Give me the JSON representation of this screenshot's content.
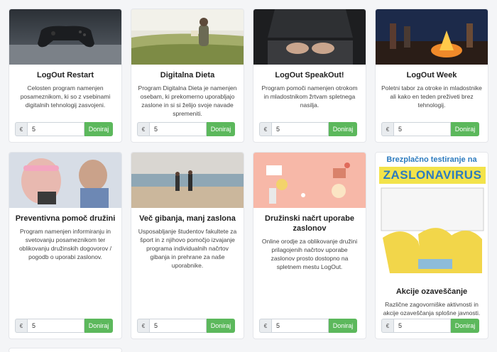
{
  "currency_symbol": "€",
  "donate_label": "Doniraj",
  "default_amount": "5",
  "programs": [
    {
      "title": "LogOut Restart",
      "desc": "Celosten program namenjen posameznikom, ki so z vsebinami digitalnih tehnologij zasvojeni."
    },
    {
      "title": "Digitalna Dieta",
      "desc": "Program Digitalna Dieta je namenjen osebam, ki prekomerno uporabljajo zaslone in si si želijo svoje navade spremeniti."
    },
    {
      "title": "LogOut SpeakOut!",
      "desc": "Program pomoči namenjen otrokom in mladostnikom žrtvam spletnega nasilja."
    },
    {
      "title": "LogOut Week",
      "desc": "Poletni tabor za otroke in mladostnike ali kako en teden preživeti brez tehnologij."
    },
    {
      "title": "Preventivna pomoč družini",
      "desc": "Program namenjen informiranju in svetovanju posameznikom ter oblikovanju družinskih dogovorov / pogodb o uporabi zaslonov."
    },
    {
      "title": "Več gibanja, manj zaslona",
      "desc": "Usposabljanje študentov fakultete za šport in z njihovo pomočjo izvajanje programa individualnih načrtov gibanja in prehrane za naše uporabnike."
    },
    {
      "title": "Družinski načrt uporabe zaslonov",
      "desc": "Online orodje za oblikovanje družini prilagojenih načrtov uporabe zaslonov prosto dostopno na spletnem mestu LogOut."
    },
    {
      "title": "Akcije ozaveščanje",
      "desc": "Različne zagovorniške aktivnosti in akcije ozaveščanja splošne javnosti."
    }
  ],
  "poster": {
    "line1": "Brezplačno testiranje na",
    "line2": "ZASLONAVIRUS"
  }
}
